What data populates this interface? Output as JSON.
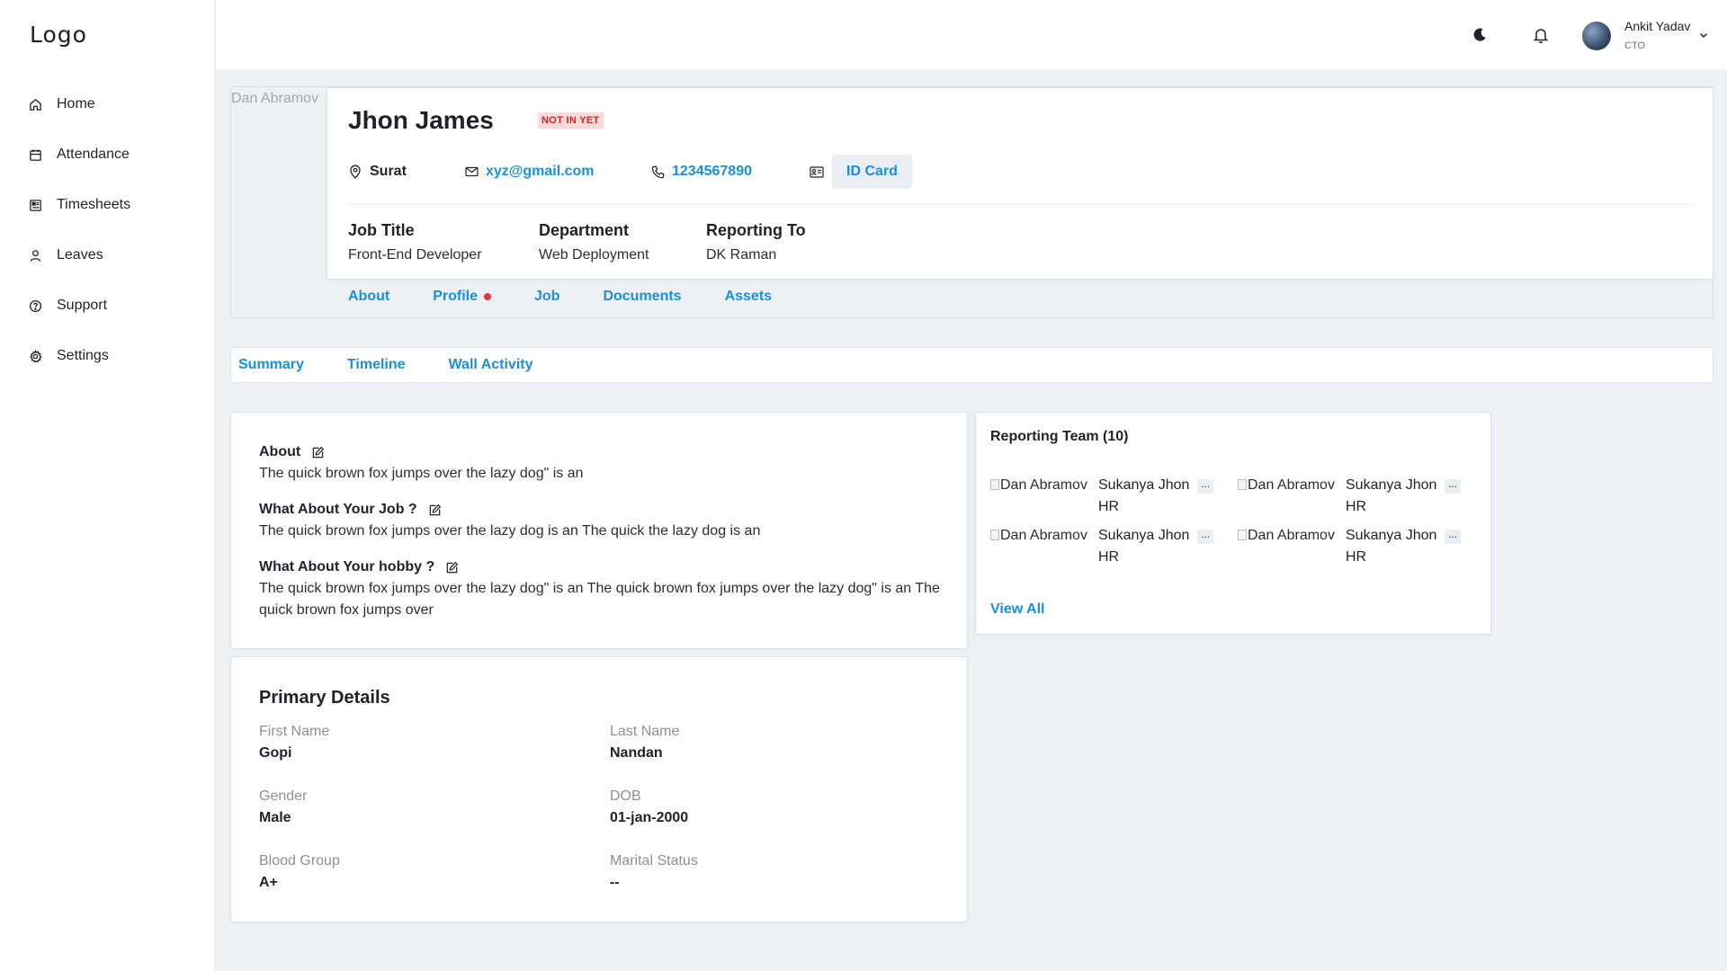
{
  "sidebar": {
    "logo": "Logo",
    "items": [
      {
        "label": "Home",
        "icon": "home-icon"
      },
      {
        "label": "Attendance",
        "icon": "calendar-icon"
      },
      {
        "label": "Timesheets",
        "icon": "timesheet-icon"
      },
      {
        "label": "Leaves",
        "icon": "user-icon"
      },
      {
        "label": "Support",
        "icon": "help-icon"
      },
      {
        "label": "Settings",
        "icon": "gear-icon"
      }
    ]
  },
  "topbar": {
    "user_name": "Ankit Yadav",
    "user_role": "CTO"
  },
  "profile": {
    "image_alt": "Dan Abramov",
    "name": "Jhon James",
    "status_badge": "NOT IN YET",
    "location": "Surat",
    "email": "xyz@gmail.com",
    "phone": "1234567890",
    "id_card_label": "ID Card",
    "job_title_label": "Job Title",
    "job_title": "Front-End Developer",
    "department_label": "Department",
    "department": "Web Deployment",
    "reporting_label": "Reporting To",
    "reporting_to": "DK Raman",
    "tabs": [
      "About",
      "Profile",
      "Job",
      "Documents",
      "Assets"
    ]
  },
  "subtabs": [
    "Summary",
    "Timeline",
    "Wall Activity"
  ],
  "about": {
    "q1_title": "About",
    "q1_text": "The quick brown fox jumps over the lazy dog\" is an",
    "q2_title": "What About Your Job ?",
    "q2_text": "The quick brown fox jumps over the lazy dog is an The quick the lazy dog is an",
    "q3_title": "What About Your hobby ?",
    "q3_text": "The quick brown fox jumps over the lazy dog\" is an The quick brown fox jumps over the lazy dog\" is an The quick brown fox jumps over"
  },
  "primary_details": {
    "title": "Primary Details",
    "first_name_label": "First Name",
    "first_name": "Gopi",
    "last_name_label": "Last Name",
    "last_name": "Nandan",
    "gender_label": "Gender",
    "gender": "Male",
    "dob_label": "DOB",
    "dob": "01-jan-2000",
    "blood_label": "Blood Group",
    "blood": "A+",
    "marital_label": "Marital Status",
    "marital": "--"
  },
  "team": {
    "title": "Reporting Team (10)",
    "members": [
      {
        "img_alt": "Dan Abramov",
        "name": "Sukanya Jhon",
        "role": "HR",
        "more": "..."
      },
      {
        "img_alt": "Dan Abramov",
        "name": "Sukanya Jhon",
        "role": "HR",
        "more": "..."
      },
      {
        "img_alt": "Dan Abramov",
        "name": "Sukanya Jhon",
        "role": "HR",
        "more": "..."
      },
      {
        "img_alt": "Dan Abramov",
        "name": "Sukanya Jhon",
        "role": "HR",
        "more": "..."
      }
    ],
    "view_all": "View All"
  },
  "colors": {
    "accent": "#1b8fdd",
    "badge_bg": "#fcd9d9",
    "badge_text": "#c62828",
    "background": "#edf1f5"
  }
}
